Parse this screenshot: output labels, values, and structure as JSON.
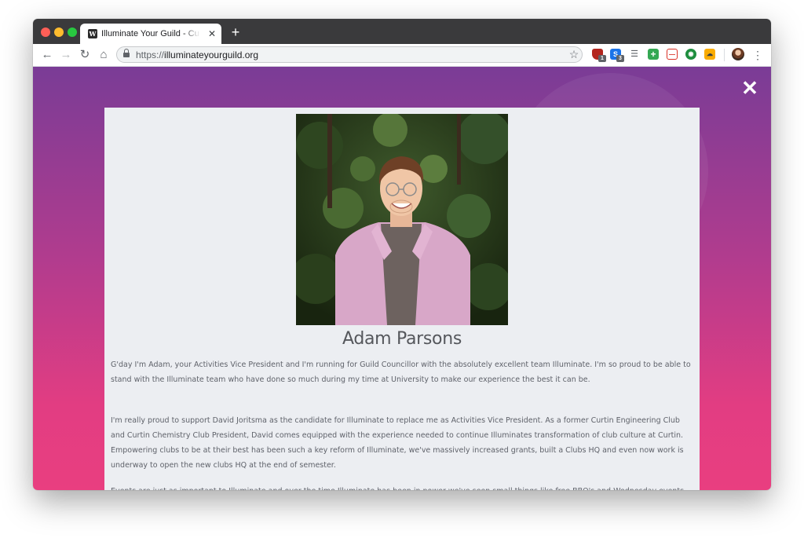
{
  "browser": {
    "tab_title": "Illuminate Your Guild - Curtin S",
    "tab_favicon_letter": "W",
    "new_tab_label": "+",
    "tab_close_label": "✕",
    "url_scheme": "https://",
    "url_host": "illuminateyourguild.org",
    "extensions": [
      {
        "name": "ublock-shield-icon",
        "label": "",
        "badge": "1",
        "color": "#b3261e"
      },
      {
        "name": "skype-s-icon",
        "label": "S",
        "badge": "3",
        "color": "#1a73e8"
      },
      {
        "name": "reader-lines-icon",
        "label": "☰",
        "color": "#5f6368"
      },
      {
        "name": "green-plus-icon",
        "label": "+",
        "color": "#34a853"
      },
      {
        "name": "red-dash-icon",
        "label": "—",
        "color": "#d93025"
      },
      {
        "name": "eye-icon",
        "label": "◉",
        "color": "#1e8e3e"
      },
      {
        "name": "cloud-icon",
        "label": "☁",
        "color": "#f9ab00"
      }
    ]
  },
  "page": {
    "close_label": "✕",
    "profile": {
      "name": "Adam Parsons",
      "paragraphs": [
        "G'day I'm Adam, your Activities Vice President and I'm running for Guild Councillor with the absolutely excellent team Illuminate. I'm so proud to be able to stand with the Illuminate team who have done so much during my time at University to make our experience the best it can be.",
        "I'm really proud to support David Joritsma as the candidate for Illuminate to replace me as Activities Vice President. As a former Curtin Engineering Club and Curtin Chemistry Club President, David comes equipped with the experience needed to continue Illuminates transformation of club culture at Curtin. Empowering clubs to be at their best has been such a key reform of Illuminate, we've massively increased grants, built a Clubs HQ and even now work is underway to open the new clubs HQ at the end of semester.",
        "Events are just as important to Illuminate and over the time Illuminate has been in power we've seen small things like free BBQ's and Wednesday events to the big things like Toy Parties"
      ]
    }
  },
  "colors": {
    "gradient_top": "#7a3c96",
    "gradient_bottom": "#e93e80",
    "modal_bg": "#eceef2",
    "text": "#5f626a"
  }
}
